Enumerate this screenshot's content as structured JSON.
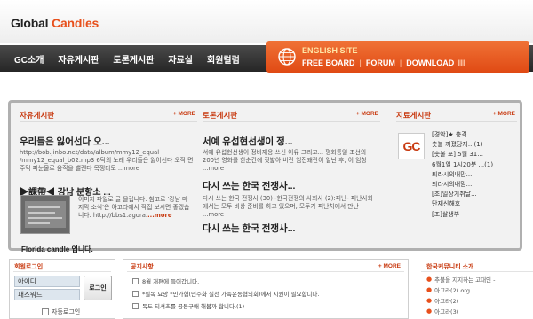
{
  "site": {
    "logo_part1": "Global ",
    "logo_part2": "Candles"
  },
  "nav": {
    "items": [
      "GC소개",
      "자유게시판",
      "토론게시판",
      "자료실",
      "회원컬럼"
    ]
  },
  "english_site": {
    "title": "ENGLISH SITE",
    "links": [
      "FREE BOARD",
      "FORUM",
      "DOWNLOAD"
    ],
    "separator": "|",
    "bars": "IIIII"
  },
  "more_label": "+ MORE",
  "board": {
    "free": {
      "title": "자유게시판",
      "headline": "우리들은 잃어선다 오...",
      "body": "http://bob.jinbo.net/data/album/mmy12_equal /mmy12_equal_b02.mp3 6탁의 노래 우리들은 잃어선다 오직 면주먹 피눈물로 움직을 밸렌다 목쟁티도 ...more",
      "sub_title": "▶課帶◀ 강남 분향소 ...",
      "sub_body": "이미지 파일로 글 올립니다. 참고로 '강남 마지막 소식'은 아고라에서 작접 보시면 좋겠습니다. http://bbs1.agora.",
      "sub_more": "...more",
      "footer": "Florida candle 입니다."
    },
    "debate": {
      "title": "토론게시판",
      "h1": "서예 유섭현선생이 정...",
      "p1": "서예 유섭현선생이 정비재용 쓰신 이유 그리고... 평화통일 조선의 200년 영화를 한순간에 짓밟아 버린 임진왜란이 일난 후, 이 엄청 ...more",
      "h2": "다시 쓰는 한국 전쟁사...",
      "p2": "다시 쓰는 한국 전쟁사 (30) -한국전쟁의 사회사 (2):피난- 피난사회에서는 모두 비상 준비를 하고 있으며, 모두가 피난처에서 만난 ...more",
      "h3": "다시 쓰는 한국 전쟁사..."
    },
    "archive": {
      "title": "지료게시판",
      "logo": "GC",
      "items": [
        "[경악]★ 충격...",
        "촛불 꺼졌당지...(1)",
        "[촛불 포] 5월 31...",
        "6월1일 1시20분 ...(1)",
        "퇴라시의내맘...",
        "퇴라시의내맘...",
        "[조]일장기취날...",
        "단재신해호",
        "[조]살생부"
      ]
    }
  },
  "login": {
    "title": "회원로그인",
    "id_label": "아이디",
    "pw_label": "패스워드",
    "button": "로그인",
    "auto": "자동로그인"
  },
  "notice": {
    "title": "공지사항",
    "items": [
      "8월 개편에 들어갑니다.",
      "*필독 요망 *민가협(민주화 실천 가족운동협의회)에서 지원이 필요합니다.",
      "독도 티셔츠를 공동구매 해봅까 합니다.(1)"
    ]
  },
  "korea_links": {
    "title": "한국커뮤니티 소개",
    "items": [
      "추불을 지지하는 고대인 -",
      "아고라(2) org",
      "아고라(2)",
      "아고라(3)"
    ]
  }
}
